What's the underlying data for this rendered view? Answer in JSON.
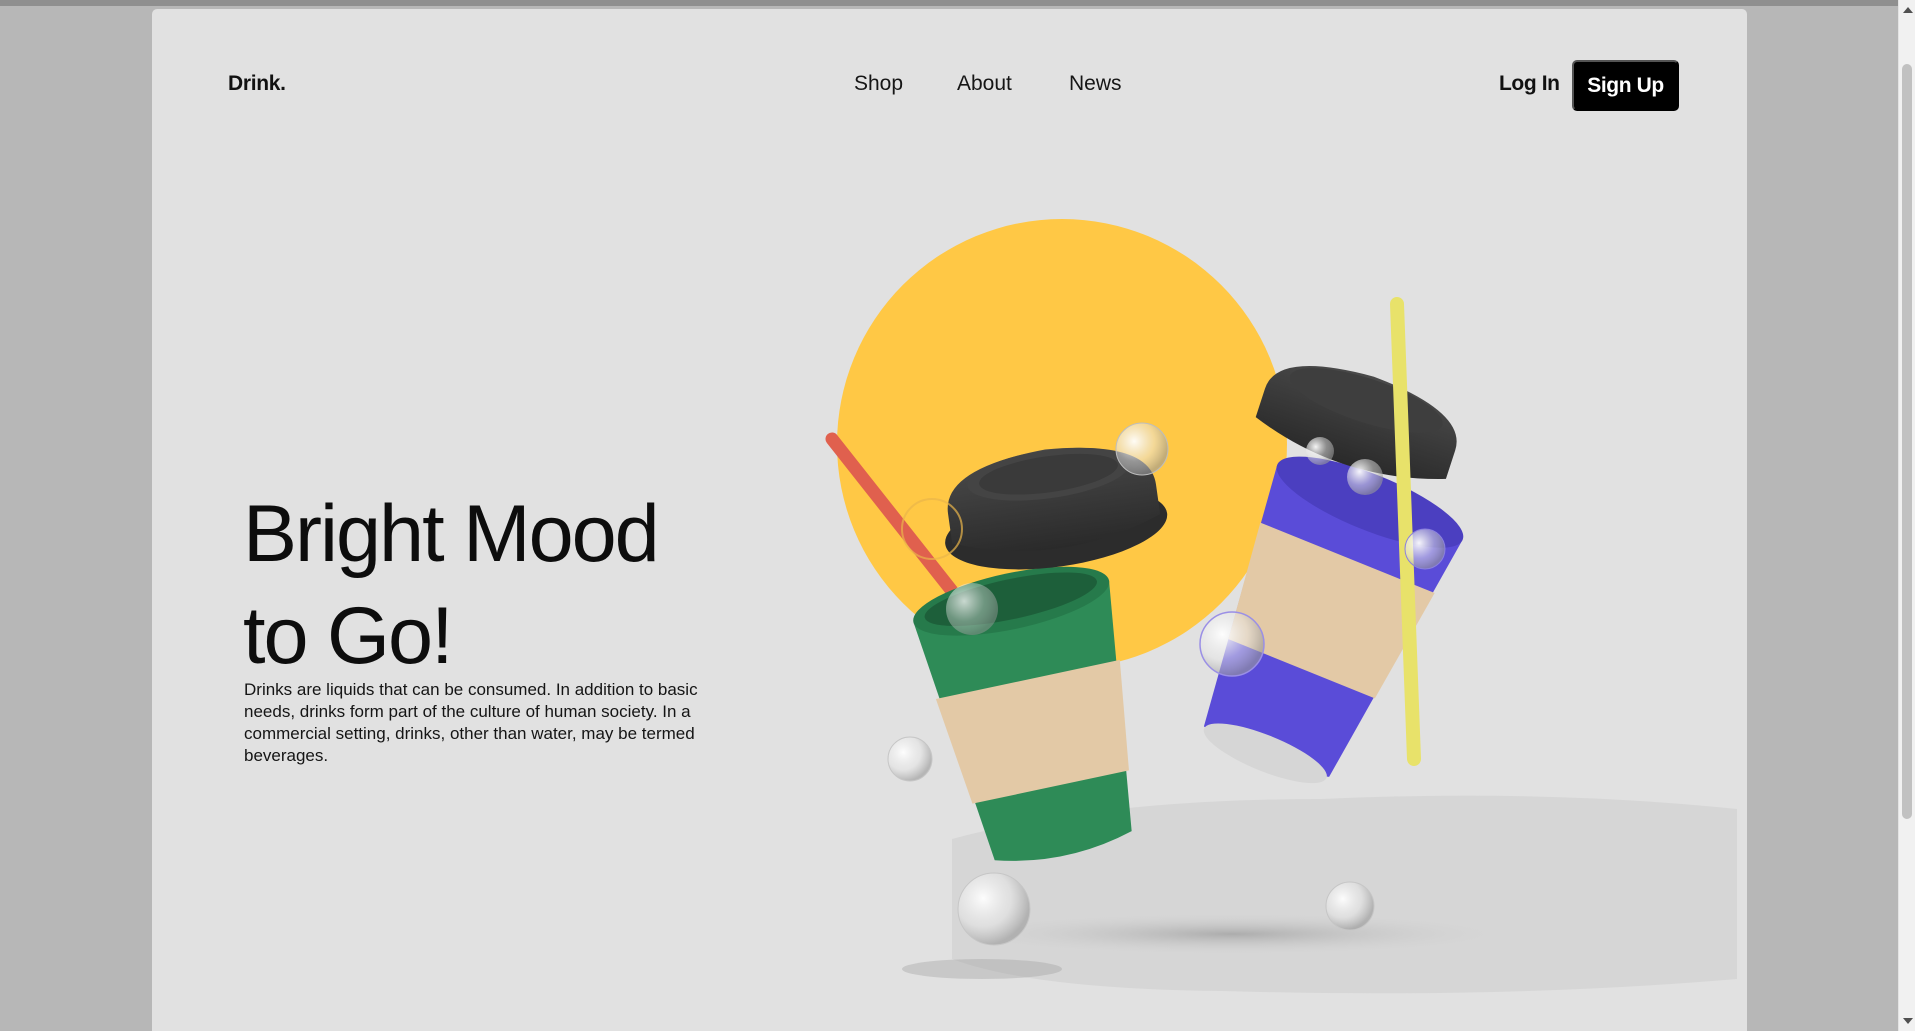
{
  "brand": {
    "logo": "Drink."
  },
  "nav": {
    "items": [
      "Shop",
      "About",
      "News"
    ]
  },
  "auth": {
    "login_label": "Log In",
    "signup_label": "Sign Up"
  },
  "hero": {
    "headline_line1": "Bright Mood",
    "headline_line2": "to Go!",
    "description": "Drinks are liquids that can be consumed. In addition to basic needs, drinks form part of the culture of human society. In a commercial setting, drinks, other than water, may be termed beverages."
  },
  "colors": {
    "page_bg": "#e1e1e1",
    "sun_yellow": "#ffc845",
    "cup_green": "#2e8b57",
    "cup_purple": "#5a4cd8",
    "kraft_sleeve": "#e3c9a6",
    "lid_dark": "#3a3a3a",
    "straw_red": "#e0604e",
    "straw_yellow": "#e8e26a",
    "button_bg": "#000000"
  }
}
